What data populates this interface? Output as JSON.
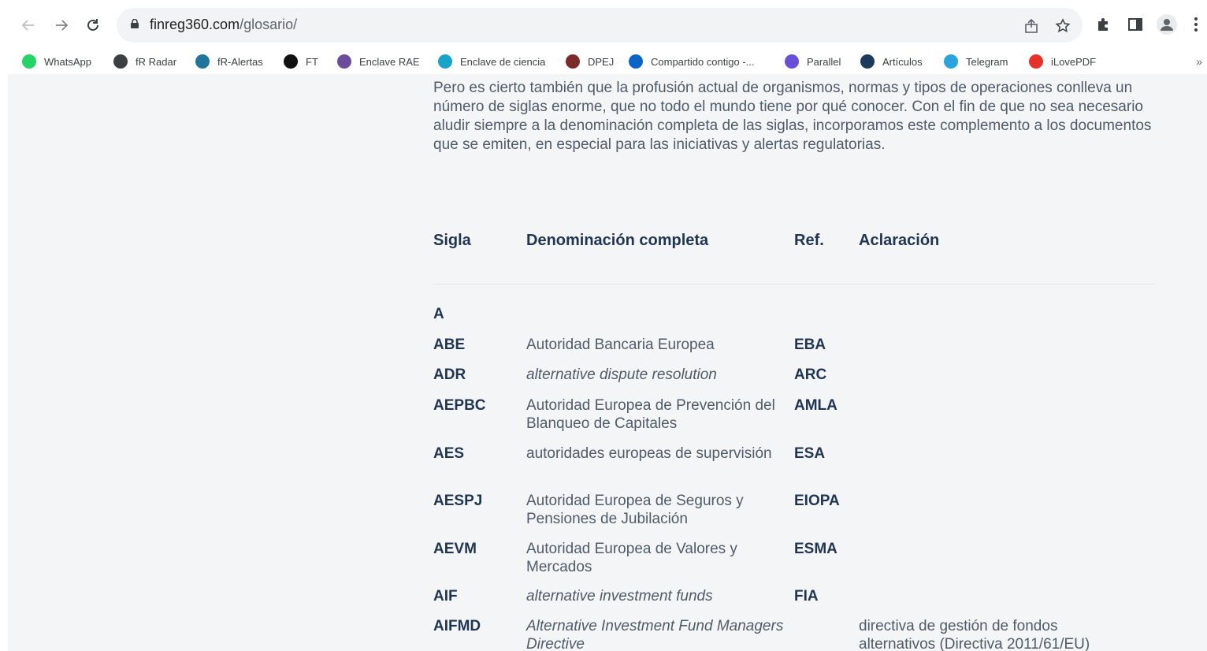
{
  "browser": {
    "url_domain": "finreg360.com",
    "url_path": "/glosario/",
    "bookmarks": [
      {
        "label": "WhatsApp",
        "icon": "whatsapp-icon",
        "color": "#25d366"
      },
      {
        "label": "fR Radar",
        "icon": "globe-icon",
        "color": "#3c4043"
      },
      {
        "label": "fR-Alertas",
        "icon": "wordpress-icon",
        "color": "#21759b"
      },
      {
        "label": "FT",
        "icon": "ft-icon",
        "color": "#111111"
      },
      {
        "label": "Enclave RAE",
        "icon": "rae-icon",
        "color": "#6b4e9b"
      },
      {
        "label": "Enclave de ciencia",
        "icon": "ciencia-icon",
        "color": "#1aa3c8"
      },
      {
        "label": "DPEJ",
        "icon": "dpej-icon",
        "color": "#7a2a2a"
      },
      {
        "label": "Compartido contigo -...",
        "icon": "onedrive-icon",
        "color": "#0a64c8"
      },
      {
        "label": "Parallel",
        "icon": "parallel-icon",
        "color": "#6a4fd8"
      },
      {
        "label": "Artículos",
        "icon": "articulos-icon",
        "color": "#1b3a5c"
      },
      {
        "label": "Telegram",
        "icon": "telegram-icon",
        "color": "#2aa3df"
      },
      {
        "label": "iLovePDF",
        "icon": "ilovepdf-icon",
        "color": "#e5322d"
      }
    ]
  },
  "intro": "Pero es cierto también que la profusión actual de organismos, normas y tipos de operaciones conlleva un número de siglas enorme, que no todo el mundo tiene por qué conocer. Con el fin de que no sea necesario aludir siempre a la denominación completa de las siglas, incorporamos este complemento a los documentos que se emiten, en especial para las iniciativas y alertas regulatorias.",
  "table": {
    "headers": {
      "sigla": "Sigla",
      "denominacion": "Denominación completa",
      "ref": "Ref.",
      "aclaracion": "Aclaración"
    },
    "letter": "A",
    "rows": [
      {
        "sigla": "ABE",
        "denominacion": "Autoridad Bancaria Europea",
        "italic": false,
        "ref": "EBA",
        "aclaracion": ""
      },
      {
        "sigla": "ADR",
        "denominacion": "alternative dispute resolution",
        "italic": true,
        "ref": "ARC",
        "aclaracion": ""
      },
      {
        "sigla": "AEPBC",
        "denominacion": "Autoridad Europea de Prevención del Blanqueo de Capitales",
        "italic": false,
        "ref": "AMLA",
        "aclaracion": ""
      },
      {
        "sigla": "AES",
        "denominacion": "autoridades europeas de supervisión",
        "italic": false,
        "ref": "ESA",
        "aclaracion": ""
      },
      {
        "sigla": "AESPJ",
        "denominacion": "Autoridad Europea de Seguros y Pensiones de Jubilación",
        "italic": false,
        "ref": "EIOPA",
        "aclaracion": ""
      },
      {
        "sigla": "AEVM",
        "denominacion": "Autoridad Europea de Valores y Mercados",
        "italic": false,
        "ref": "ESMA",
        "aclaracion": ""
      },
      {
        "sigla": "AIF",
        "denominacion": "alternative investment funds",
        "italic": true,
        "ref": "FIA",
        "aclaracion": ""
      },
      {
        "sigla": "AIFMD",
        "denominacion": "Alternative Investment Fund Managers Directive",
        "italic": true,
        "ref": "",
        "aclaracion": "directiva de gestión de fondos alternativos (Directiva 2011/61/EU)"
      }
    ]
  }
}
